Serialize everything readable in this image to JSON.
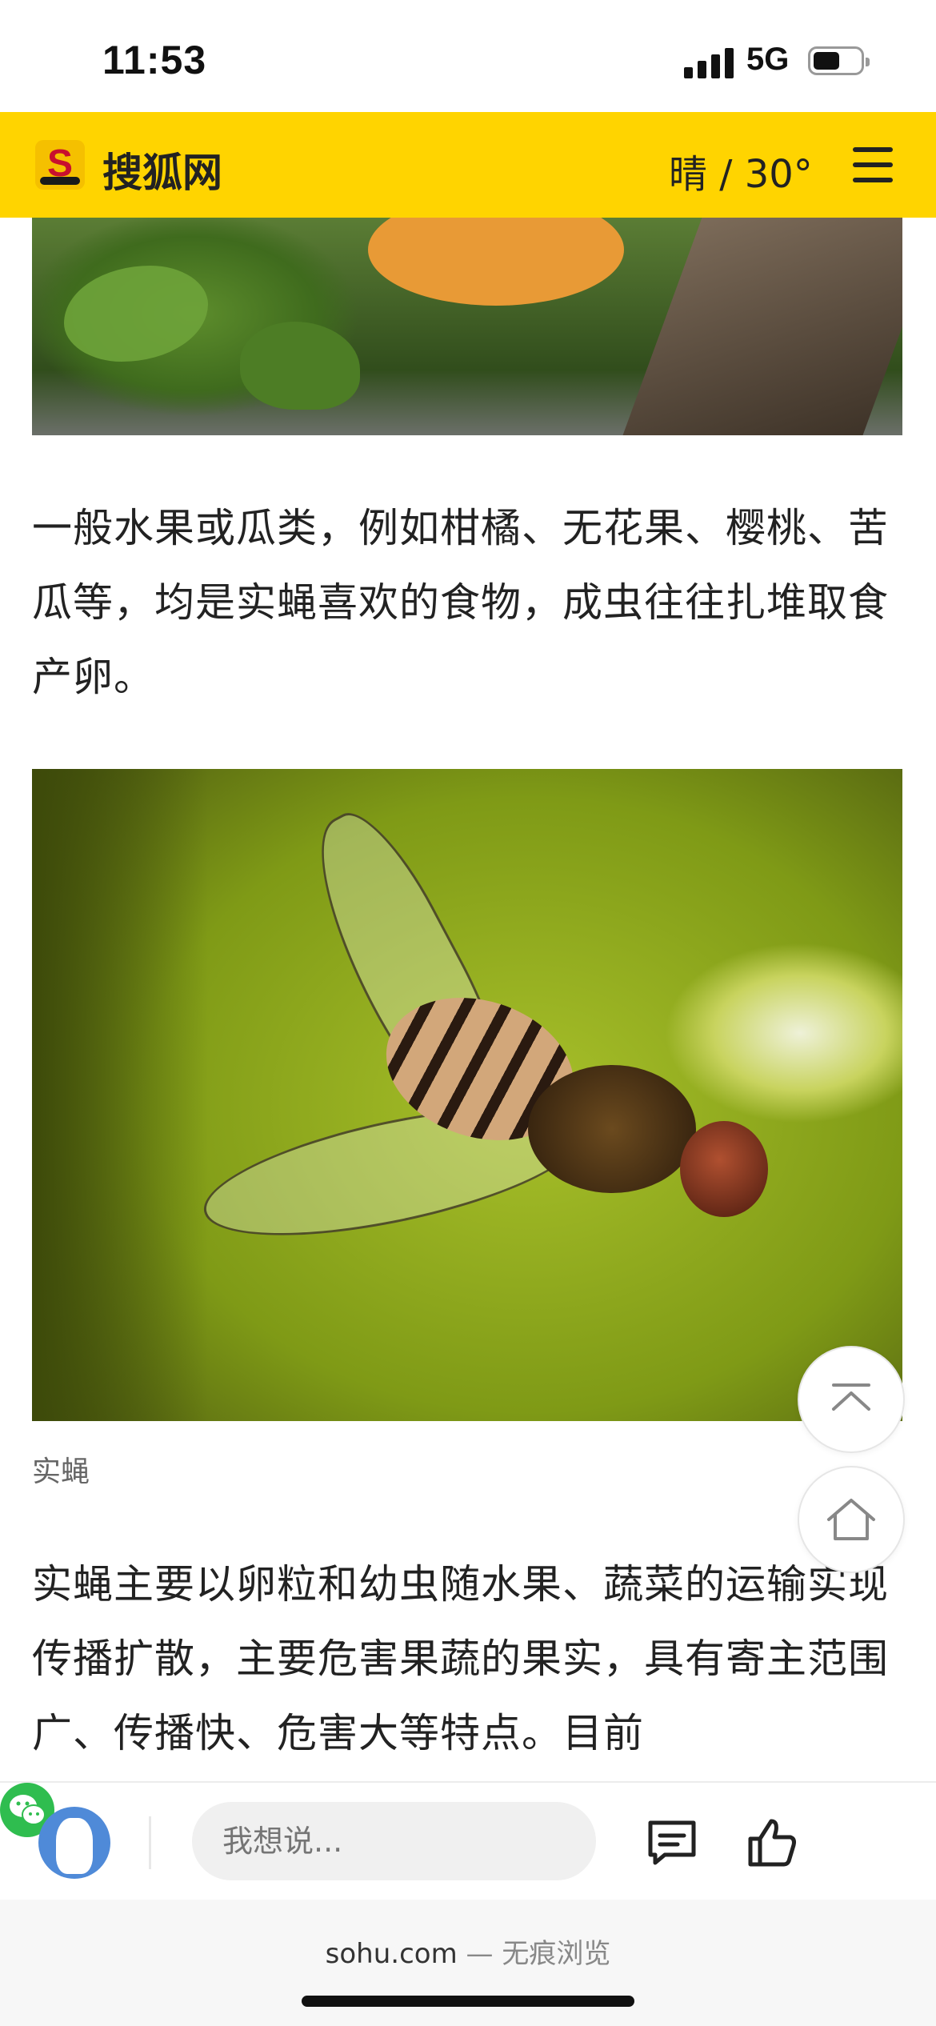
{
  "status_bar": {
    "time": "11:53",
    "network": "5G"
  },
  "header": {
    "site_name": "搜狐网",
    "logo_letter": "S",
    "weather": "晴 / 30°"
  },
  "article": {
    "paragraph1": "一般水果或瓜类，例如柑橘、无花果、樱桃、苦瓜等，均是实蝇喜欢的食物，成虫往往扎堆取食产卵。",
    "image_caption": "实蝇",
    "paragraph2": "实蝇主要以卵粒和幼虫随水果、蔬菜的运输实现传播扩散，主要危害果蔬的果实，具有寄主范围广、传播快、危害大等特点。目前"
  },
  "comment_bar": {
    "placeholder": "我想说..."
  },
  "browser_footer": {
    "domain": "sohu.com",
    "separator": " — ",
    "mode": "无痕浏览"
  },
  "colors": {
    "header_bg": "#ffd400",
    "wechat": "#2fbd4f",
    "avatar": "#4f8ad8"
  },
  "icons": [
    "signal-icon",
    "battery-icon",
    "menu-icon",
    "back-to-top-icon",
    "home-icon",
    "comment-icon",
    "like-icon",
    "wechat-icon"
  ]
}
